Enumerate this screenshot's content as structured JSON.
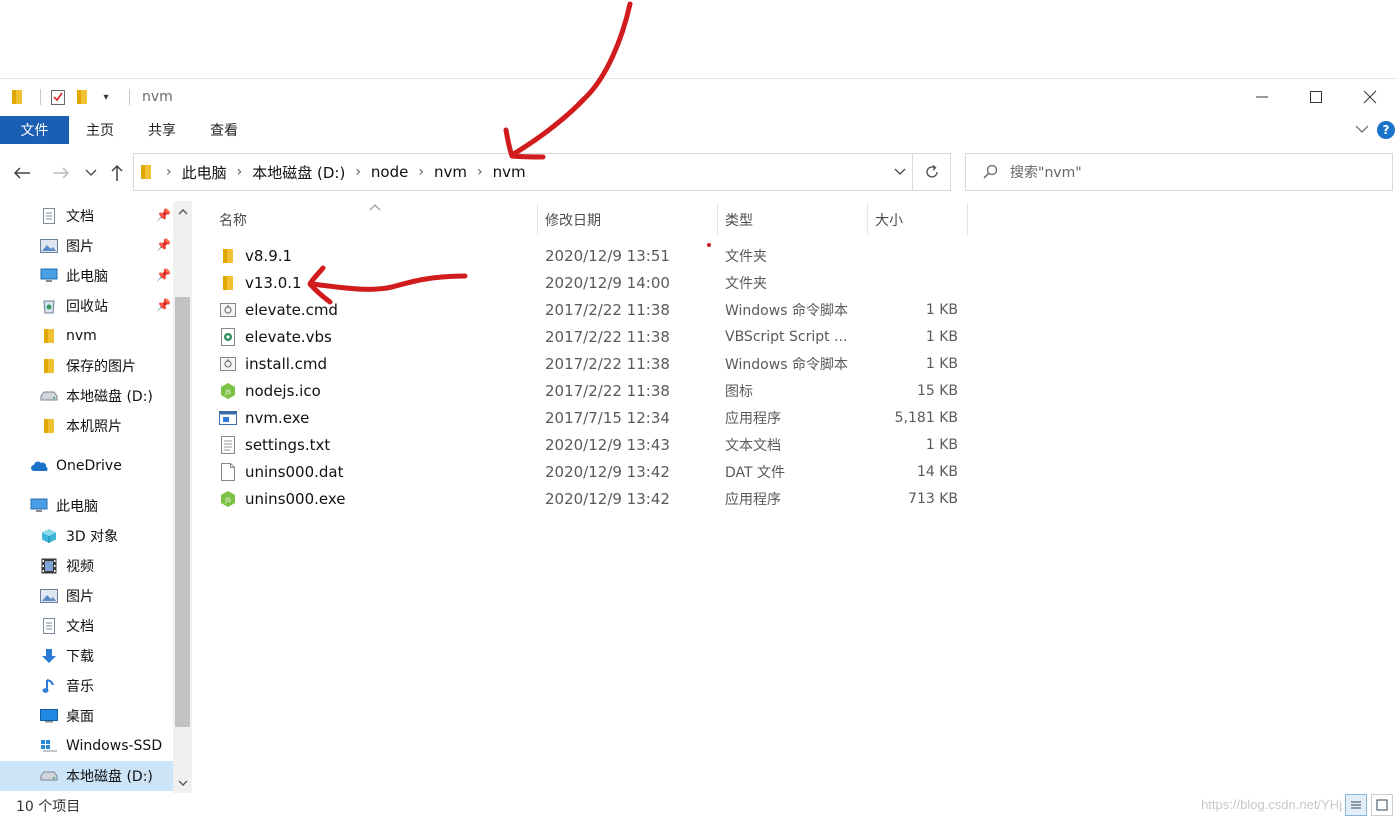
{
  "window": {
    "title": "nvm"
  },
  "ribbon": {
    "tabs": [
      "文件",
      "主页",
      "共享",
      "查看"
    ],
    "help": "?"
  },
  "nav": {
    "breadcrumb": [
      "此电脑",
      "本地磁盘 (D:)",
      "node",
      "nvm",
      "nvm"
    ],
    "search_placeholder": "搜索\"nvm\""
  },
  "sidebar": {
    "items": [
      {
        "label": "文档",
        "icon": "document-icon"
      },
      {
        "label": "图片",
        "icon": "picture-icon"
      },
      {
        "label": "此电脑",
        "icon": "computer-icon"
      },
      {
        "label": "回收站",
        "icon": "recycle-bin-icon"
      },
      {
        "label": "nvm",
        "icon": "folder-icon"
      },
      {
        "label": "保存的图片",
        "icon": "folder-icon"
      },
      {
        "label": "本地磁盘 (D:)",
        "icon": "drive-icon"
      },
      {
        "label": "本机照片",
        "icon": "folder-icon"
      },
      {
        "label": "OneDrive",
        "icon": "onedrive-icon"
      },
      {
        "label": "此电脑",
        "icon": "computer-icon"
      },
      {
        "label": "3D 对象",
        "icon": "3d-objects-icon"
      },
      {
        "label": "视频",
        "icon": "video-icon"
      },
      {
        "label": "图片",
        "icon": "picture-icon"
      },
      {
        "label": "文档",
        "icon": "document-icon"
      },
      {
        "label": "下载",
        "icon": "download-icon"
      },
      {
        "label": "音乐",
        "icon": "music-icon"
      },
      {
        "label": "桌面",
        "icon": "desktop-icon"
      },
      {
        "label": "Windows-SSD",
        "icon": "windows-drive-icon"
      },
      {
        "label": "本地磁盘 (D:)",
        "icon": "drive-icon"
      }
    ]
  },
  "columns": {
    "name": "名称",
    "date": "修改日期",
    "type": "类型",
    "size": "大小"
  },
  "files": [
    {
      "name": "v8.9.1",
      "date": "2020/12/9 13:51",
      "type": "文件夹",
      "size": "",
      "icon": "folder-icon"
    },
    {
      "name": "v13.0.1",
      "date": "2020/12/9 14:00",
      "type": "文件夹",
      "size": "",
      "icon": "folder-icon"
    },
    {
      "name": "elevate.cmd",
      "date": "2017/2/22 11:38",
      "type": "Windows 命令脚本",
      "size": "1 KB",
      "icon": "cmd-script-icon"
    },
    {
      "name": "elevate.vbs",
      "date": "2017/2/22 11:38",
      "type": "VBScript Script ...",
      "size": "1 KB",
      "icon": "vbs-script-icon"
    },
    {
      "name": "install.cmd",
      "date": "2017/2/22 11:38",
      "type": "Windows 命令脚本",
      "size": "1 KB",
      "icon": "cmd-script-icon"
    },
    {
      "name": "nodejs.ico",
      "date": "2017/2/22 11:38",
      "type": "图标",
      "size": "15 KB",
      "icon": "nodejs-icon"
    },
    {
      "name": "nvm.exe",
      "date": "2017/7/15 12:34",
      "type": "应用程序",
      "size": "5,181 KB",
      "icon": "application-icon"
    },
    {
      "name": "settings.txt",
      "date": "2020/12/9 13:43",
      "type": "文本文档",
      "size": "1 KB",
      "icon": "text-file-icon"
    },
    {
      "name": "unins000.dat",
      "date": "2020/12/9 13:42",
      "type": "DAT 文件",
      "size": "14 KB",
      "icon": "blank-file-icon"
    },
    {
      "name": "unins000.exe",
      "date": "2020/12/9 13:42",
      "type": "应用程序",
      "size": "713 KB",
      "icon": "nodejs-icon"
    }
  ],
  "status": {
    "count": "10 个项目"
  },
  "watermark": "https://blog.csdn.net/YHj",
  "colors": {
    "accent": "#1a5fb4",
    "folder": "#f2c033",
    "annotation": "#d01c1c"
  }
}
